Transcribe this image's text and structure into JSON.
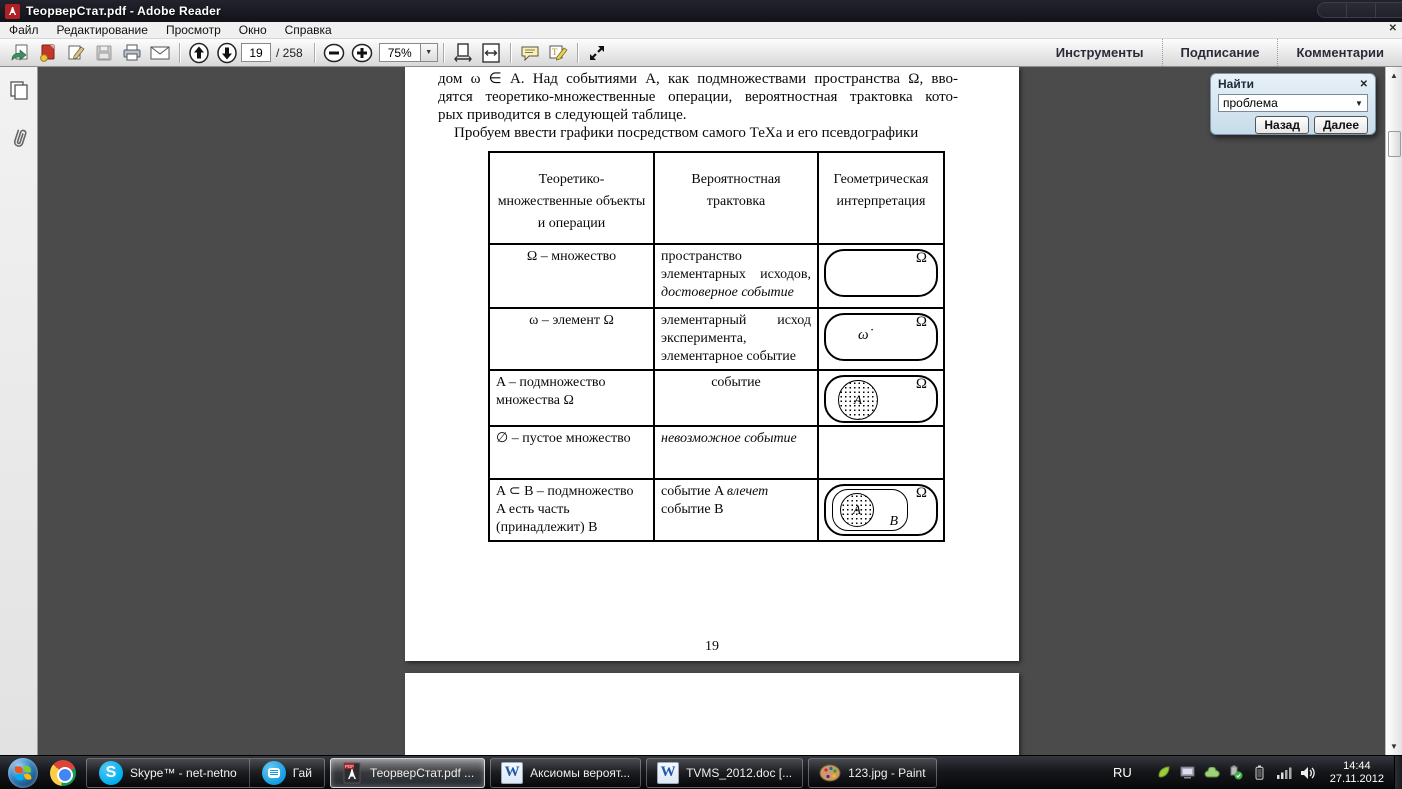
{
  "window": {
    "title": "ТеорверСтат.pdf - Adobe Reader"
  },
  "menu": {
    "items": [
      "Файл",
      "Редактирование",
      "Просмотр",
      "Окно",
      "Справка"
    ]
  },
  "toolbar": {
    "page_number": "19",
    "page_total": "/ 258",
    "zoom_level": "75%",
    "tabs": [
      "Инструменты",
      "Подписание",
      "Комментарии"
    ]
  },
  "find": {
    "title": "Найти",
    "query": "проблема",
    "back_label": "Назад",
    "next_label": "Далее"
  },
  "icons": {
    "close_glyph": "✕",
    "combo_arrow": "▼",
    "zoom_dd_arrow": "▼",
    "scroll_up": "▲",
    "scroll_down": "▼"
  },
  "doc": {
    "line1": "дом ω ∈ A. Над событиями A, как подмножествами пространства Ω, вво-",
    "line2": "дятся теоретико-множественные операции, вероятностная трактовка кото-",
    "line3": "рых приводится в следующей таблице.",
    "line4": "Пробуем ввести графики посредством самого ТеХа и его псевдографики",
    "page_num": "19",
    "table": {
      "h1": "Теоретико-множественные объекты и операции",
      "h2": "Вероятностная трактовка",
      "h3": "Геометрическая интерпретация",
      "rows": [
        {
          "c1": "Ω – множество",
          "c2a": "пространство элементарных исходов, ",
          "c2b": "достоверное событие",
          "omega": "Ω"
        },
        {
          "c1": "ω – элемент Ω",
          "c2": "элементарный исход эксперимента, элементарное событие",
          "omega": "Ω",
          "omega_dot": "ω̇"
        },
        {
          "c1": "A – подмножество множества Ω",
          "c2": "событие",
          "omega": "Ω",
          "a": "A"
        },
        {
          "c1": "∅ – пустое множество",
          "c2": "невозможное событие"
        },
        {
          "c1": "A ⊂ B – подмножество A есть часть (принадлежит) B",
          "c2a": "событие A ",
          "c2b": "влечет",
          "c2c": " событие B",
          "omega": "Ω",
          "a": "A",
          "b": "B"
        }
      ]
    }
  },
  "taskbar": {
    "skype_label": "Skype™ - net-netno",
    "gai_label": "Гай",
    "pdf_label": "ТеорверСтат.pdf ...",
    "word1_label": "Аксиомы вероят...",
    "word2_label": "TVMS_2012.doc [...",
    "paint_label": "123.jpg - Paint",
    "tray": {
      "lang": "RU",
      "time": "14:44",
      "date": "27.11.2012"
    }
  },
  "colors": {
    "skype_blue": "#00aff0",
    "find_panel_blue": "#cfe2ee",
    "doc_background": "#4b4b4b",
    "word_blue": "#1d5aa8"
  }
}
